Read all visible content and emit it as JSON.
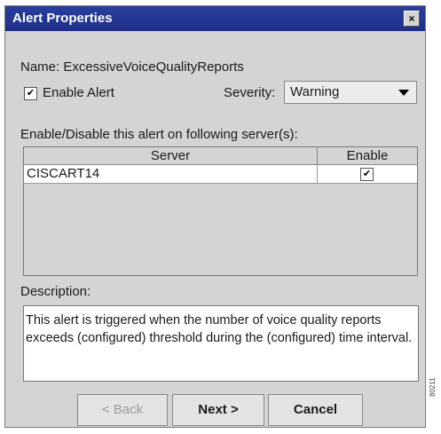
{
  "window": {
    "title": "Alert Properties",
    "close_glyph": "×"
  },
  "name_line": "Name: ExcessiveVoiceQualityReports",
  "enable_alert": {
    "label": "Enable Alert",
    "checked": true
  },
  "severity": {
    "label": "Severity:",
    "value": "Warning"
  },
  "servers_label": "Enable/Disable this alert on following server(s):",
  "table": {
    "columns": [
      "Server",
      "Enable"
    ],
    "rows": [
      {
        "server": "CISCART14",
        "enabled": true
      }
    ]
  },
  "description": {
    "label": "Description:",
    "text": "This alert is triggered when the number of voice quality reports exceeds (configured) threshold during the (configured) time interval."
  },
  "buttons": {
    "back": "< Back",
    "next": "Next >",
    "cancel": "Cancel"
  },
  "icons": {
    "checkmark": "✔",
    "dropdown": "dropdown-arrow-icon"
  },
  "watermark": "80211"
}
